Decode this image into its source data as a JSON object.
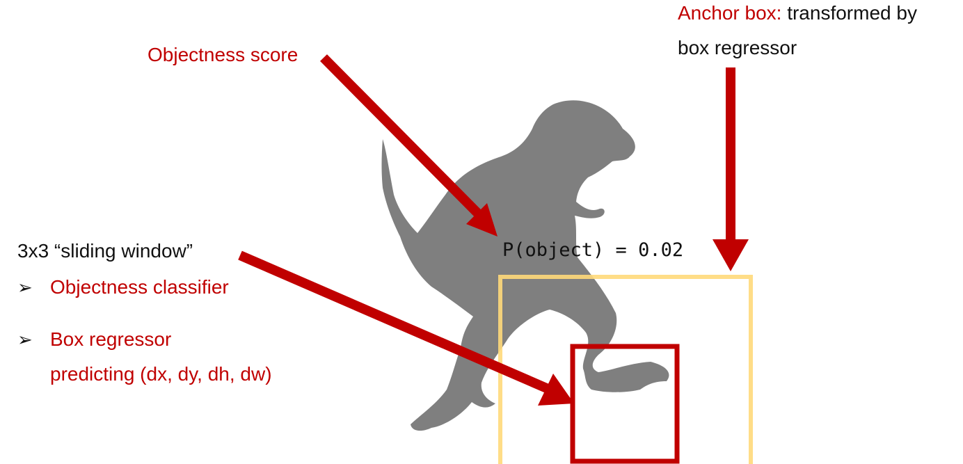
{
  "labels": {
    "objectness_score": "Objectness score",
    "anchor_box_prefix": "Anchor box:",
    "anchor_box_rest": " transformed by",
    "anchor_box_line2": "box regressor",
    "sliding_window": "3x3 “sliding window”",
    "bullet_symbol": "➢",
    "objectness_classifier": "Objectness classifier",
    "box_regressor": "Box regressor",
    "box_regressor_detail": "predicting (dx, dy, dh, dw)",
    "probability": "P(object) = 0.02"
  },
  "colors": {
    "accent_red": "#c00000",
    "anchor_box": "#ffd97a",
    "silhouette": "#7f7f7f",
    "text": "#111111"
  },
  "icons": {
    "dinosaur": "t-rex-silhouette"
  }
}
